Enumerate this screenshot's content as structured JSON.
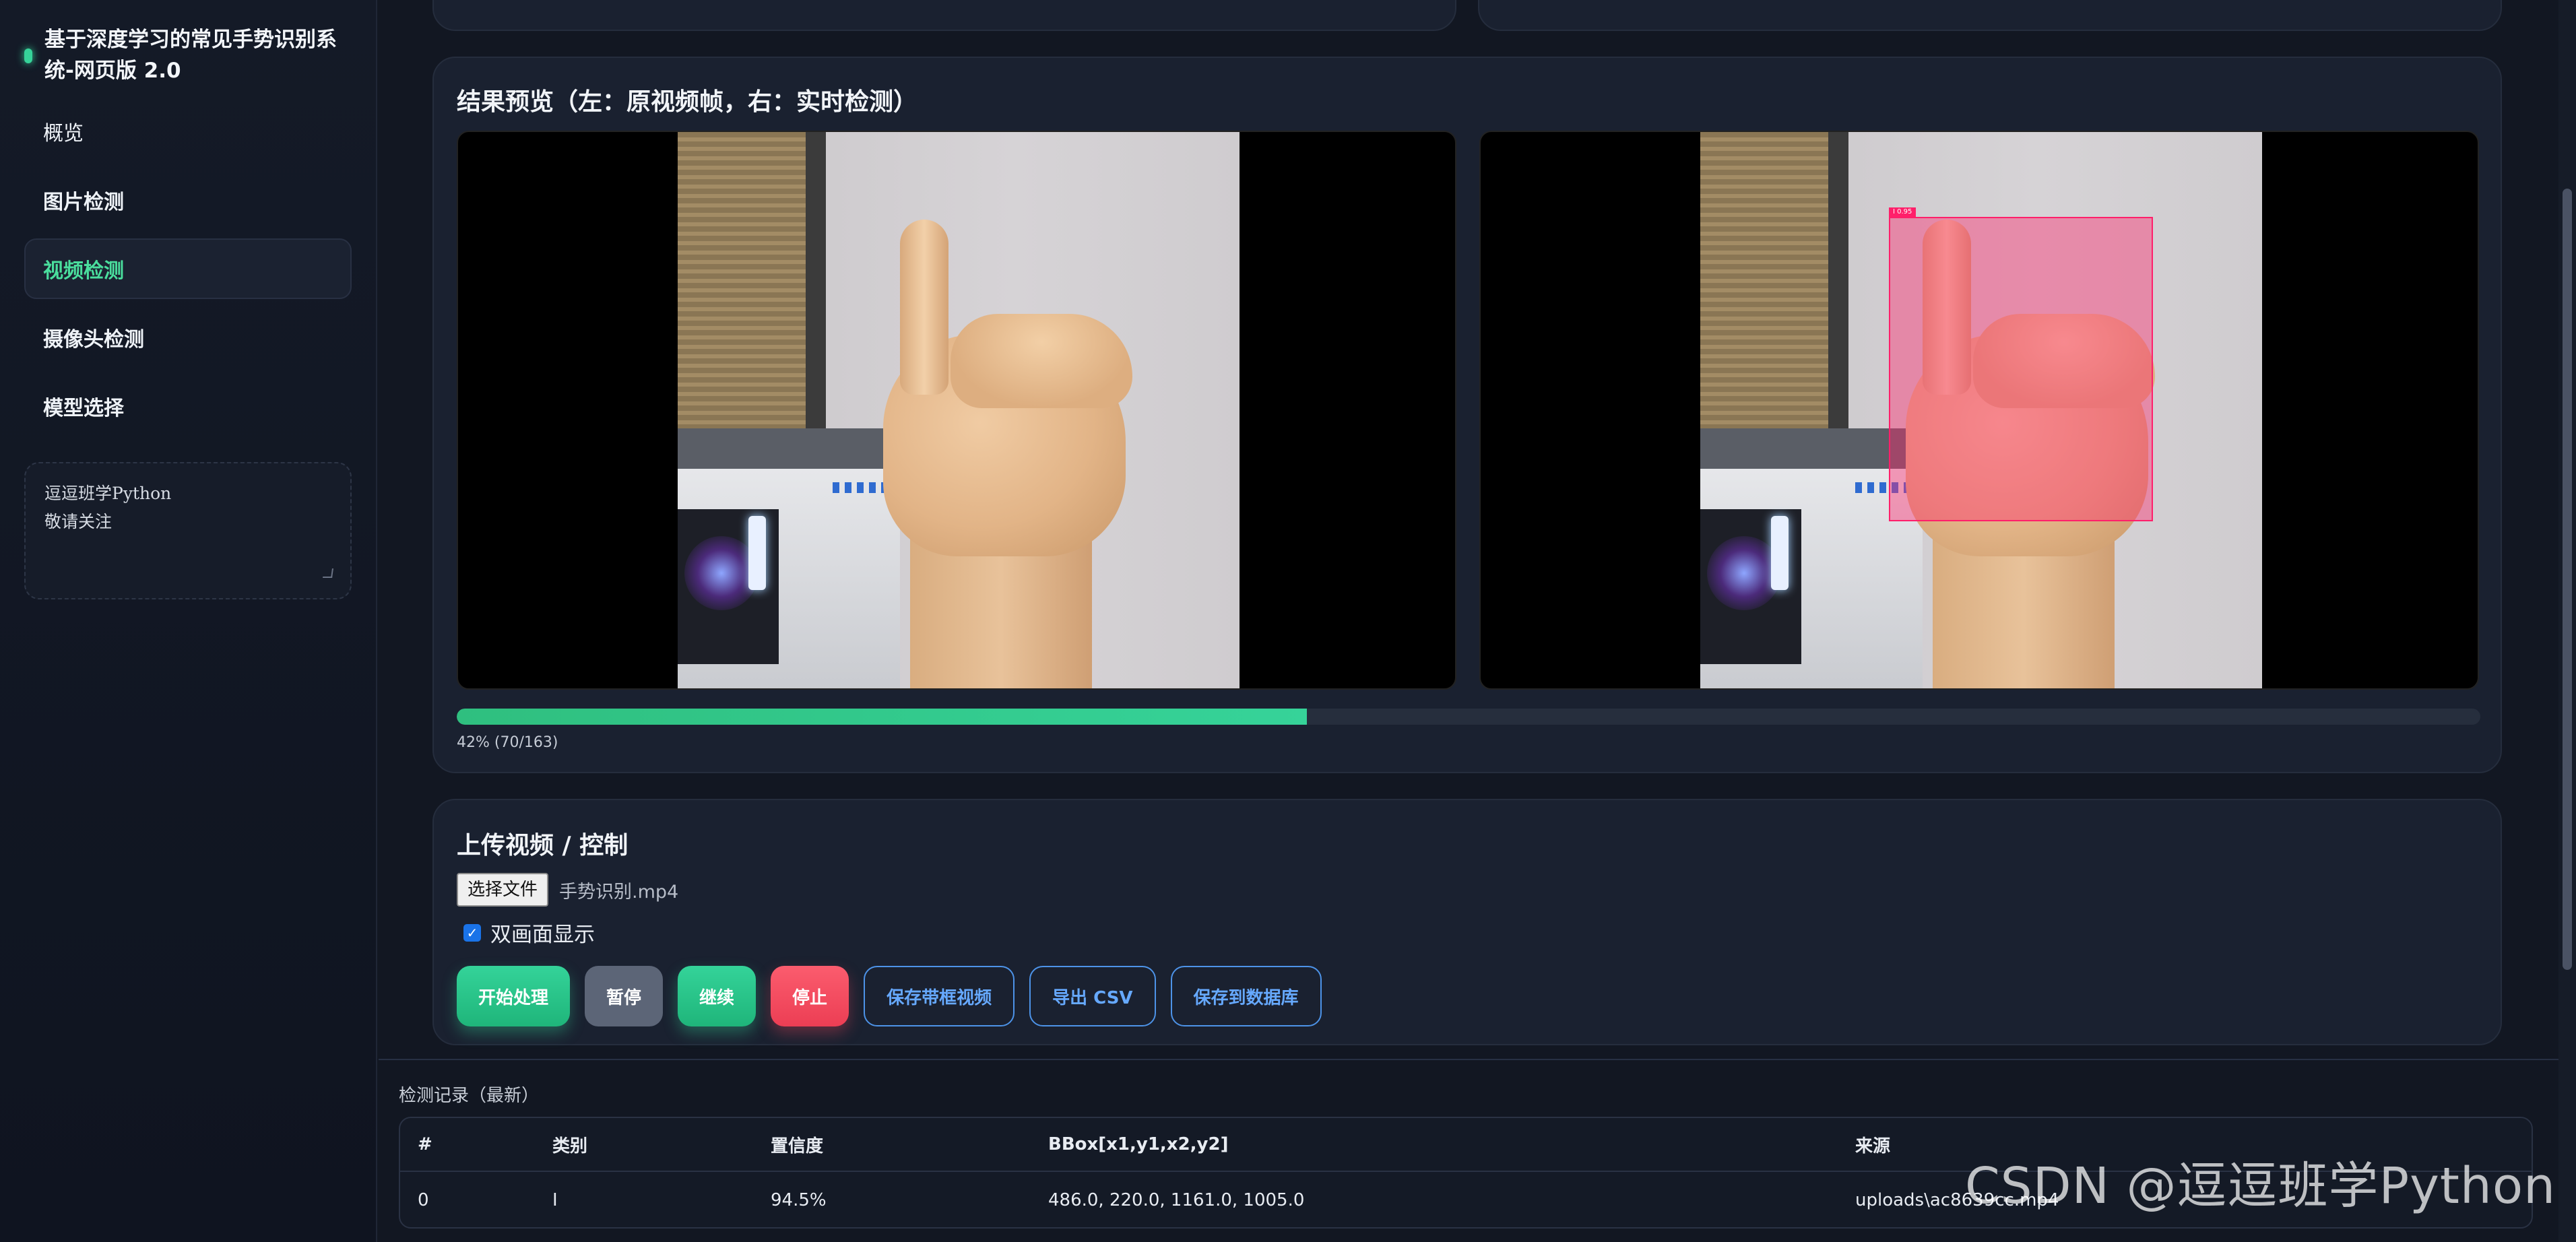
{
  "app": {
    "title": "基于深度学习的常见手势识别系统-网页版 2.0",
    "accent_color": "#36d399"
  },
  "sidebar": {
    "items": [
      {
        "label": "概览"
      },
      {
        "label": "图片检测"
      },
      {
        "label": "视频检测",
        "active": true
      },
      {
        "label": "摄像头检测"
      },
      {
        "label": "模型选择"
      }
    ],
    "note": {
      "line1": "逗逗班学Python",
      "line2": "敬请关注"
    }
  },
  "preview": {
    "title": "结果预览（左：原视频帧，右：实时检测）",
    "detection_label": "I 0.95",
    "progress": {
      "fraction": 0.42,
      "text": "42% (70/163)"
    }
  },
  "upload": {
    "title": "上传视频 / 控制",
    "file_button": "选择文件",
    "file_name": "手势识别.mp4",
    "dual_view_label": "双画面显示",
    "dual_view_checked": true,
    "buttons": {
      "start": "开始处理",
      "pause": "暂停",
      "resume": "继续",
      "stop": "停止",
      "save_video": "保存带框视频",
      "export_csv": "导出 CSV",
      "save_db": "保存到数据库"
    }
  },
  "records": {
    "label": "检测记录（最新）",
    "columns": [
      "#",
      "类别",
      "置信度",
      "BBox[x1,y1,x2,y2]",
      "来源"
    ],
    "rows": [
      [
        "0",
        "I",
        "94.5%",
        "486.0, 220.0, 1161.0, 1005.0",
        "uploads\\ac8639cc.mp4"
      ]
    ]
  },
  "watermark": "CSDN @逗逗班学Python"
}
